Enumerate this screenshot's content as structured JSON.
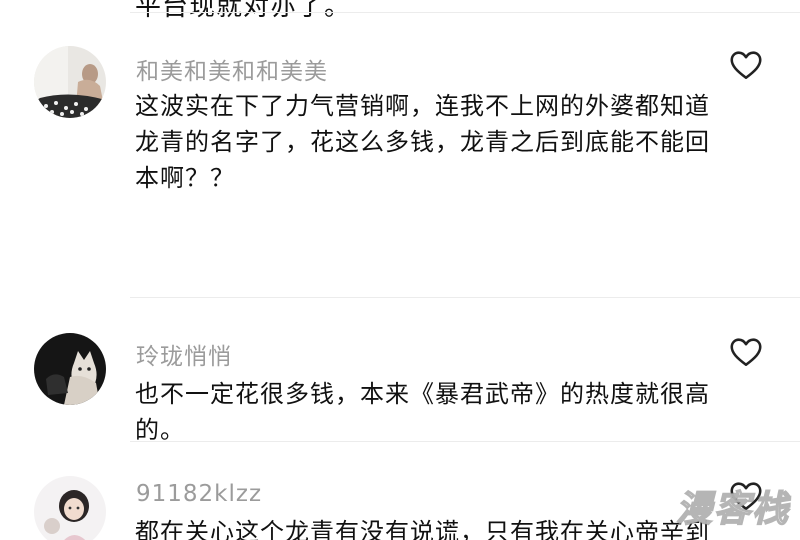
{
  "top_cut_text": "平台现就对亦了。",
  "comments": [
    {
      "author": "和美和美和和美美",
      "text": "这波实在下了力气营销啊，连我不上网的外婆都知道龙青的名字了，花这么多钱，龙青之后到底能不能回本啊？？",
      "avatar_icon": "user-avatar-photo-woman"
    },
    {
      "author": "玲珑悄悄",
      "text": "也不一定花很多钱，本来《暴君武帝》的热度就很高的。",
      "avatar_icon": "user-avatar-photo-cat"
    },
    {
      "author": "91182klzz",
      "text": "都在关心这个龙青有没有说谎，只有我在关心帝辛到",
      "avatar_icon": "user-avatar-photo-girl"
    }
  ],
  "icons": {
    "like": "heart-outline-icon"
  },
  "watermark": "漫客栈",
  "colors": {
    "author": "#9b9b9b",
    "text": "#111111",
    "divider": "#ececec"
  }
}
